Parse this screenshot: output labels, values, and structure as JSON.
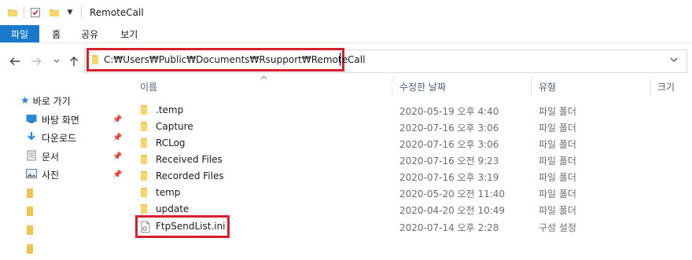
{
  "window": {
    "title": "RemoteCall"
  },
  "ribbon": {
    "tabs": [
      "파일",
      "홈",
      "공유",
      "보기"
    ]
  },
  "address": {
    "path": "C:₩Users₩Public₩Documents₩Rsupport₩RemoteCall"
  },
  "nav": {
    "quick_access": "바로 가기",
    "items": [
      {
        "label": "바탕 화면",
        "icon": "desktop-icon",
        "pinned": true
      },
      {
        "label": "다운로드",
        "icon": "download-icon",
        "pinned": true
      },
      {
        "label": "문서",
        "icon": "document-icon",
        "pinned": true
      },
      {
        "label": "사진",
        "icon": "pictures-icon",
        "pinned": true
      }
    ]
  },
  "columns": {
    "name": "이름",
    "date": "수정한 날짜",
    "type": "유형",
    "size": "크기"
  },
  "files": [
    {
      "name": ".temp",
      "date": "2020-05-19 오후 4:40",
      "type": "파일 폴더",
      "kind": "folder"
    },
    {
      "name": "Capture",
      "date": "2020-07-16 오후 3:06",
      "type": "파일 폴더",
      "kind": "folder"
    },
    {
      "name": "RCLog",
      "date": "2020-07-16 오후 3:06",
      "type": "파일 폴더",
      "kind": "folder"
    },
    {
      "name": "Received Files",
      "date": "2020-07-16 오전 9:23",
      "type": "파일 폴더",
      "kind": "folder"
    },
    {
      "name": "Recorded Files",
      "date": "2020-07-16 오후 3:19",
      "type": "파일 폴더",
      "kind": "folder"
    },
    {
      "name": "temp",
      "date": "2020-05-20 오전 11:40",
      "type": "파일 폴더",
      "kind": "folder"
    },
    {
      "name": "update",
      "date": "2020-04-20 오전 10:49",
      "type": "파일 폴더",
      "kind": "folder"
    },
    {
      "name": "FtpSendList.ini",
      "date": "2020-07-14 오후 2:28",
      "type": "구성 설정",
      "kind": "ini"
    }
  ],
  "colors": {
    "accent": "#1979ca",
    "folder": "#f0c24f",
    "highlight": "#d7202d"
  }
}
